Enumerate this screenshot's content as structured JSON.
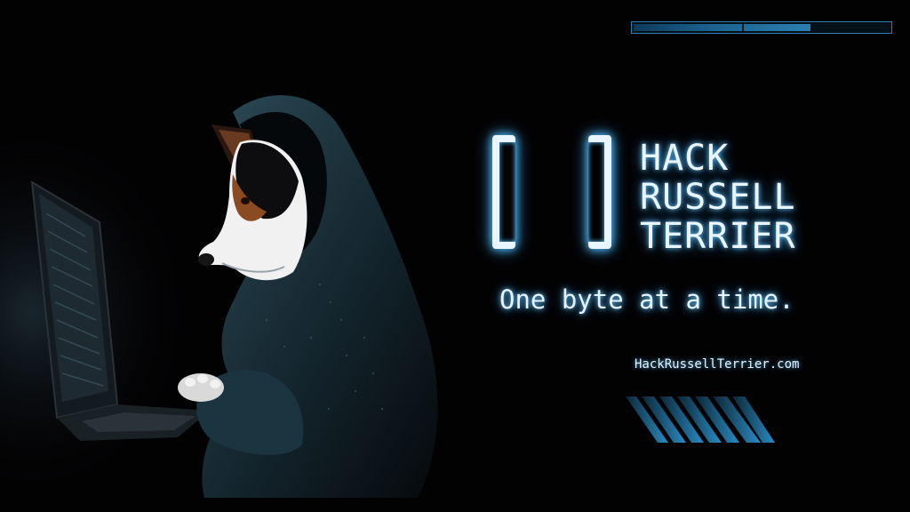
{
  "progress": {
    "fraction": 0.69,
    "bar_color": "#2f7fb4"
  },
  "logo": {
    "bracket_glyphs": "[ ]",
    "title_lines": [
      "HACK",
      "RUSSELL",
      "TERRIER"
    ]
  },
  "tagline": "One byte at a time.",
  "url": "HackRussellTerrier.com",
  "illustration": {
    "subject": "dog-in-hoodie-at-laptop",
    "accent_color": "#2a9bd6",
    "hoodie_color": "#1f3a45"
  }
}
